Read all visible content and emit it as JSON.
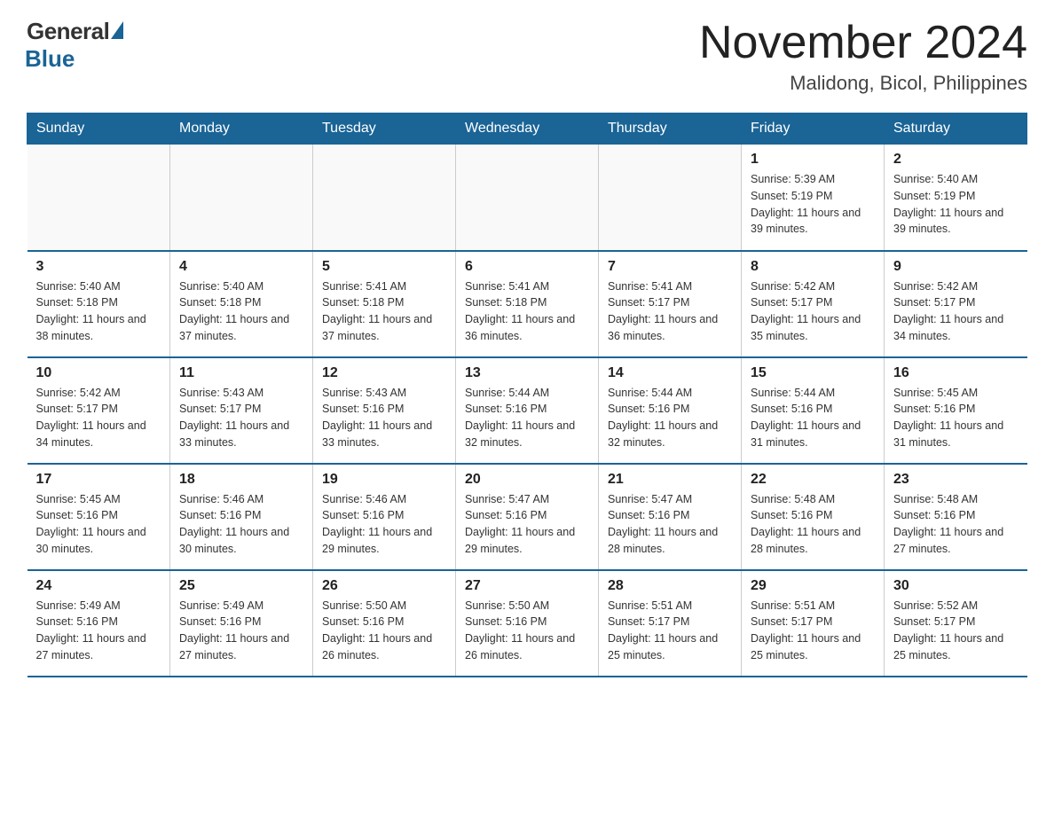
{
  "logo": {
    "general": "General",
    "blue": "Blue"
  },
  "title": "November 2024",
  "location": "Malidong, Bicol, Philippines",
  "days_header": [
    "Sunday",
    "Monday",
    "Tuesday",
    "Wednesday",
    "Thursday",
    "Friday",
    "Saturday"
  ],
  "weeks": [
    [
      {
        "day": "",
        "info": ""
      },
      {
        "day": "",
        "info": ""
      },
      {
        "day": "",
        "info": ""
      },
      {
        "day": "",
        "info": ""
      },
      {
        "day": "",
        "info": ""
      },
      {
        "day": "1",
        "info": "Sunrise: 5:39 AM\nSunset: 5:19 PM\nDaylight: 11 hours and 39 minutes."
      },
      {
        "day": "2",
        "info": "Sunrise: 5:40 AM\nSunset: 5:19 PM\nDaylight: 11 hours and 39 minutes."
      }
    ],
    [
      {
        "day": "3",
        "info": "Sunrise: 5:40 AM\nSunset: 5:18 PM\nDaylight: 11 hours and 38 minutes."
      },
      {
        "day": "4",
        "info": "Sunrise: 5:40 AM\nSunset: 5:18 PM\nDaylight: 11 hours and 37 minutes."
      },
      {
        "day": "5",
        "info": "Sunrise: 5:41 AM\nSunset: 5:18 PM\nDaylight: 11 hours and 37 minutes."
      },
      {
        "day": "6",
        "info": "Sunrise: 5:41 AM\nSunset: 5:18 PM\nDaylight: 11 hours and 36 minutes."
      },
      {
        "day": "7",
        "info": "Sunrise: 5:41 AM\nSunset: 5:17 PM\nDaylight: 11 hours and 36 minutes."
      },
      {
        "day": "8",
        "info": "Sunrise: 5:42 AM\nSunset: 5:17 PM\nDaylight: 11 hours and 35 minutes."
      },
      {
        "day": "9",
        "info": "Sunrise: 5:42 AM\nSunset: 5:17 PM\nDaylight: 11 hours and 34 minutes."
      }
    ],
    [
      {
        "day": "10",
        "info": "Sunrise: 5:42 AM\nSunset: 5:17 PM\nDaylight: 11 hours and 34 minutes."
      },
      {
        "day": "11",
        "info": "Sunrise: 5:43 AM\nSunset: 5:17 PM\nDaylight: 11 hours and 33 minutes."
      },
      {
        "day": "12",
        "info": "Sunrise: 5:43 AM\nSunset: 5:16 PM\nDaylight: 11 hours and 33 minutes."
      },
      {
        "day": "13",
        "info": "Sunrise: 5:44 AM\nSunset: 5:16 PM\nDaylight: 11 hours and 32 minutes."
      },
      {
        "day": "14",
        "info": "Sunrise: 5:44 AM\nSunset: 5:16 PM\nDaylight: 11 hours and 32 minutes."
      },
      {
        "day": "15",
        "info": "Sunrise: 5:44 AM\nSunset: 5:16 PM\nDaylight: 11 hours and 31 minutes."
      },
      {
        "day": "16",
        "info": "Sunrise: 5:45 AM\nSunset: 5:16 PM\nDaylight: 11 hours and 31 minutes."
      }
    ],
    [
      {
        "day": "17",
        "info": "Sunrise: 5:45 AM\nSunset: 5:16 PM\nDaylight: 11 hours and 30 minutes."
      },
      {
        "day": "18",
        "info": "Sunrise: 5:46 AM\nSunset: 5:16 PM\nDaylight: 11 hours and 30 minutes."
      },
      {
        "day": "19",
        "info": "Sunrise: 5:46 AM\nSunset: 5:16 PM\nDaylight: 11 hours and 29 minutes."
      },
      {
        "day": "20",
        "info": "Sunrise: 5:47 AM\nSunset: 5:16 PM\nDaylight: 11 hours and 29 minutes."
      },
      {
        "day": "21",
        "info": "Sunrise: 5:47 AM\nSunset: 5:16 PM\nDaylight: 11 hours and 28 minutes."
      },
      {
        "day": "22",
        "info": "Sunrise: 5:48 AM\nSunset: 5:16 PM\nDaylight: 11 hours and 28 minutes."
      },
      {
        "day": "23",
        "info": "Sunrise: 5:48 AM\nSunset: 5:16 PM\nDaylight: 11 hours and 27 minutes."
      }
    ],
    [
      {
        "day": "24",
        "info": "Sunrise: 5:49 AM\nSunset: 5:16 PM\nDaylight: 11 hours and 27 minutes."
      },
      {
        "day": "25",
        "info": "Sunrise: 5:49 AM\nSunset: 5:16 PM\nDaylight: 11 hours and 27 minutes."
      },
      {
        "day": "26",
        "info": "Sunrise: 5:50 AM\nSunset: 5:16 PM\nDaylight: 11 hours and 26 minutes."
      },
      {
        "day": "27",
        "info": "Sunrise: 5:50 AM\nSunset: 5:16 PM\nDaylight: 11 hours and 26 minutes."
      },
      {
        "day": "28",
        "info": "Sunrise: 5:51 AM\nSunset: 5:17 PM\nDaylight: 11 hours and 25 minutes."
      },
      {
        "day": "29",
        "info": "Sunrise: 5:51 AM\nSunset: 5:17 PM\nDaylight: 11 hours and 25 minutes."
      },
      {
        "day": "30",
        "info": "Sunrise: 5:52 AM\nSunset: 5:17 PM\nDaylight: 11 hours and 25 minutes."
      }
    ]
  ]
}
